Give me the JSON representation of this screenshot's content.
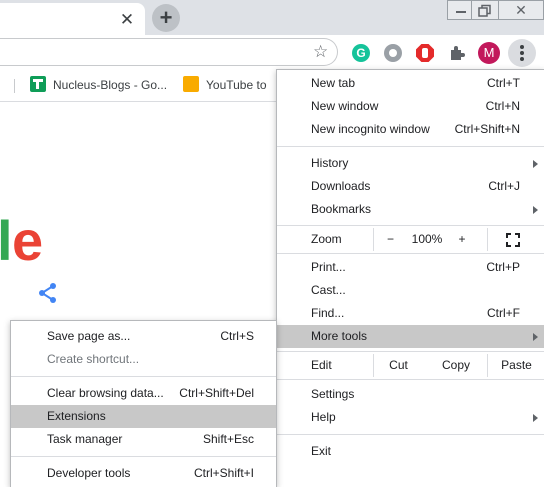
{
  "toolbar": {
    "avatar_letter": "M",
    "grammarly_letter": "G"
  },
  "bookmarks": [
    {
      "label": "Nucleus-Blogs - Go..."
    },
    {
      "label": "YouTube to"
    }
  ],
  "page": {
    "logo_l": "l",
    "logo_e": "e"
  },
  "main_menu": {
    "new_tab": {
      "label": "New tab",
      "shortcut": "Ctrl+T"
    },
    "new_window": {
      "label": "New window",
      "shortcut": "Ctrl+N"
    },
    "new_incognito": {
      "label": "New incognito window",
      "shortcut": "Ctrl+Shift+N"
    },
    "history": {
      "label": "History"
    },
    "downloads": {
      "label": "Downloads",
      "shortcut": "Ctrl+J"
    },
    "bookmarks": {
      "label": "Bookmarks"
    },
    "zoom": {
      "label": "Zoom",
      "minus": "−",
      "value": "100%",
      "plus": "+"
    },
    "print": {
      "label": "Print...",
      "shortcut": "Ctrl+P"
    },
    "cast": {
      "label": "Cast..."
    },
    "find": {
      "label": "Find...",
      "shortcut": "Ctrl+F"
    },
    "more_tools": {
      "label": "More tools"
    },
    "edit": {
      "label": "Edit",
      "cut": "Cut",
      "copy": "Copy",
      "paste": "Paste"
    },
    "settings": {
      "label": "Settings"
    },
    "help": {
      "label": "Help"
    },
    "exit": {
      "label": "Exit"
    }
  },
  "more_tools_menu": {
    "save_page": {
      "label": "Save page as...",
      "shortcut": "Ctrl+S"
    },
    "create_shortcut": {
      "label": "Create shortcut..."
    },
    "clear_data": {
      "label": "Clear browsing data...",
      "shortcut": "Ctrl+Shift+Del"
    },
    "extensions": {
      "label": "Extensions"
    },
    "task_manager": {
      "label": "Task manager",
      "shortcut": "Shift+Esc"
    },
    "developer_tools": {
      "label": "Developer tools",
      "shortcut": "Ctrl+Shift+I"
    }
  },
  "colors": {
    "highlight": "#c8c8c8",
    "avatar": "#c2185b",
    "logo_green": "#34a853",
    "logo_red": "#ea4335"
  }
}
